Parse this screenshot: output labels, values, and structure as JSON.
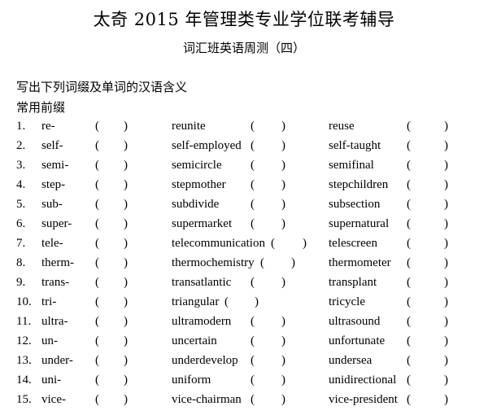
{
  "header": {
    "title": "太奇 2015 年管理类专业学位联考辅导",
    "subtitle": "词汇班英语周测（四）"
  },
  "instructions": "写出下列词缀及单词的汉语含义",
  "section_title": "常用前缀",
  "paren_open": "(",
  "paren_close": ")",
  "items": [
    {
      "num": "1.",
      "prefix": "re-",
      "word1": "reunite",
      "word2": "reuse"
    },
    {
      "num": "2.",
      "prefix": "self-",
      "word1": "self-employed",
      "word2": "self-taught"
    },
    {
      "num": "3.",
      "prefix": "semi-",
      "word1": "semicircle",
      "word2": "semifinal"
    },
    {
      "num": "4.",
      "prefix": "step-",
      "word1": "stepmother",
      "word2": "stepchildren"
    },
    {
      "num": "5.",
      "prefix": "sub-",
      "word1": "subdivide",
      "word2": "subsection"
    },
    {
      "num": "6.",
      "prefix": "super-",
      "word1": "supermarket",
      "word2": "supernatural"
    },
    {
      "num": "7.",
      "prefix": "tele-",
      "word1": "telecommunication",
      "word2": "telescreen"
    },
    {
      "num": "8.",
      "prefix": "therm-",
      "word1": "thermochemistry",
      "word2": "thermometer"
    },
    {
      "num": "9.",
      "prefix": "trans-",
      "word1": "transatlantic",
      "word2": "transplant"
    },
    {
      "num": "10.",
      "prefix": "tri-",
      "word1": "triangular",
      "word2": "tricycle"
    },
    {
      "num": "11.",
      "prefix": "ultra-",
      "word1": "ultramodern",
      "word2": "ultrasound"
    },
    {
      "num": "12.",
      "prefix": "un-",
      "word1": "uncertain",
      "word2": "unfortunate"
    },
    {
      "num": "13.",
      "prefix": "under-",
      "word1": "underdevelop",
      "word2": "undersea"
    },
    {
      "num": "14.",
      "prefix": "uni-",
      "word1": "uniform",
      "word2": "unidirectional"
    },
    {
      "num": "15.",
      "prefix": "vice-",
      "word1": "vice-chairman",
      "word2": "vice-president"
    }
  ]
}
